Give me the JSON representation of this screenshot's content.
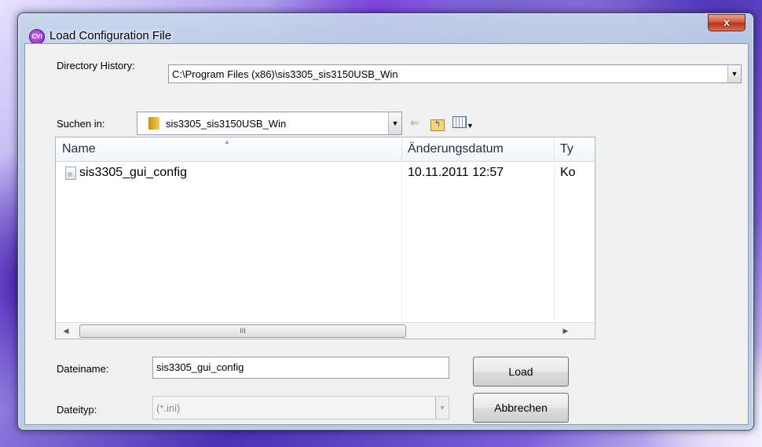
{
  "window": {
    "title": "Load Configuration File",
    "close_glyph": "x"
  },
  "directory_history": {
    "label": "Directory History:",
    "value": "C:\\Program Files (x86)\\sis3305_sis3150USB_Win"
  },
  "look_in": {
    "label": "Suchen in:",
    "value": "sis3305_sis3150USB_Win"
  },
  "toolbar": {
    "back_icon": "back-arrow-icon",
    "up_icon": "folder-up-icon",
    "view_icon": "view-menu-icon"
  },
  "file_list": {
    "columns": [
      "Name",
      "Änderungsdatum",
      "Ty"
    ],
    "rows": [
      {
        "name": "sis3305_gui_config",
        "modified": "10.11.2011 12:57",
        "type": "Ko"
      }
    ],
    "scroll_thumb_grip": "III"
  },
  "filename": {
    "label": "Dateiname:",
    "value": "sis3305_gui_config"
  },
  "filetype": {
    "label": "Dateityp:",
    "value": "(*.ini)"
  },
  "buttons": {
    "load": "Load",
    "cancel": "Abbrechen"
  },
  "colors": {
    "titlebar": "#c8d7eb",
    "close_button": "#c9452c",
    "folder": "#e8b830"
  }
}
